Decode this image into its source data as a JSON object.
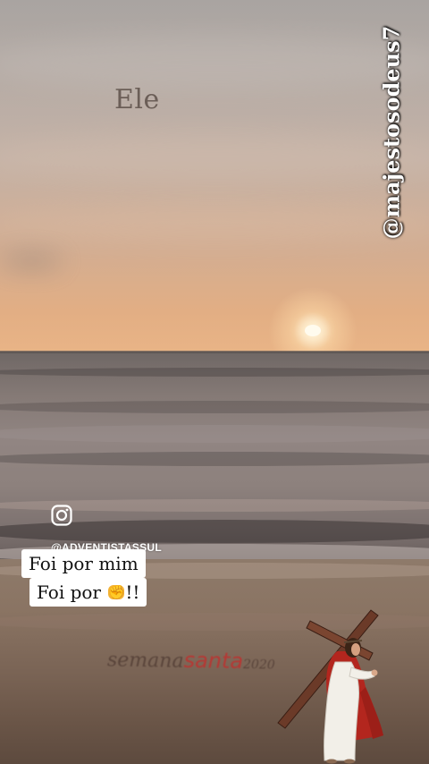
{
  "overlay_text": "Ele",
  "watermark_handle": "@majestosodeus7",
  "instagram": {
    "icon": "instagram-icon",
    "username": "@ADVENTISTASSUL"
  },
  "caption": {
    "line1": "Foi por mim",
    "line2_text": "Foi por ",
    "line2_emoji": "fist-emoji",
    "line2_suffix": "!!"
  },
  "sand_logo": {
    "word1": "semana",
    "word2": "santa",
    "year": "2020"
  },
  "figure": "jesus-carrying-cross",
  "colors": {
    "sky_top": "#a9a4a1",
    "sunset": "#e9b486",
    "sea": "#857a76",
    "sand": "#7a6455",
    "caption_bg": "#ffffff",
    "robe_red": "#c0392b"
  }
}
